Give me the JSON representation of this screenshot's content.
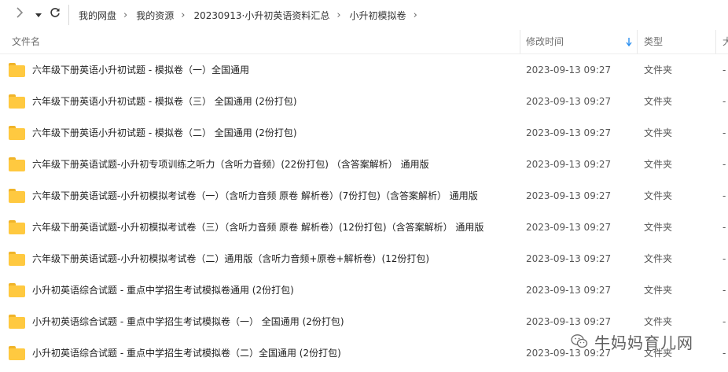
{
  "breadcrumbs": [
    "我的网盘",
    "我的资源",
    "20230913·小升初英语资料汇总",
    "小升初模拟卷"
  ],
  "columns": {
    "name": "文件名",
    "modified": "修改时间",
    "type": "类型",
    "size": "大"
  },
  "rows": [
    {
      "name": "六年级下册英语小升初试题 - 模拟卷（一）全国通用",
      "date": "2023-09-13 09:27",
      "type": "文件夹",
      "size": "-"
    },
    {
      "name": "六年级下册英语小升初试题 - 模拟卷（三） 全国通用 (2份打包)",
      "date": "2023-09-13 09:27",
      "type": "文件夹",
      "size": "-"
    },
    {
      "name": "六年级下册英语小升初试题 - 模拟卷（二） 全国通用 (2份打包)",
      "date": "2023-09-13 09:27",
      "type": "文件夹",
      "size": "-"
    },
    {
      "name": "六年级下册英语试题-小升初专项训练之听力（含听力音频）(22份打包) （含答案解析） 通用版",
      "date": "2023-09-13 09:27",
      "type": "文件夹",
      "size": "-"
    },
    {
      "name": "六年级下册英语试题-小升初模拟考试卷（一）（含听力音频 原卷 解析卷）(7份打包)（含答案解析） 通用版",
      "date": "2023-09-13 09:27",
      "type": "文件夹",
      "size": "-"
    },
    {
      "name": "六年级下册英语试题-小升初模拟考试卷（三）（含听力音频 原卷 解析卷）(12份打包)（含答案解析） 通用版",
      "date": "2023-09-13 09:27",
      "type": "文件夹",
      "size": "-"
    },
    {
      "name": "六年级下册英语试题-小升初模拟考试卷（二）通用版（含听力音频+原卷+解析卷）(12份打包)",
      "date": "2023-09-13 09:27",
      "type": "文件夹",
      "size": "-"
    },
    {
      "name": "小升初英语综合试题 - 重点中学招生考试模拟卷通用 (2份打包)",
      "date": "2023-09-13 09:27",
      "type": "文件夹",
      "size": "-"
    },
    {
      "name": "小升初英语综合试题 - 重点中学招生考试模拟卷（一） 全国通用 (2份打包)",
      "date": "2023-09-13 09:27",
      "type": "文件夹",
      "size": "-"
    },
    {
      "name": "小升初英语综合试题 - 重点中学招生考试模拟卷（二）全国通用 (2份打包)",
      "date": "2023-09-13 09:27",
      "type": "文件夹",
      "size": "-"
    }
  ],
  "watermark": "牛妈妈育儿网",
  "colors": {
    "folder": "#ffc940",
    "accent": "#2b8ff0"
  }
}
